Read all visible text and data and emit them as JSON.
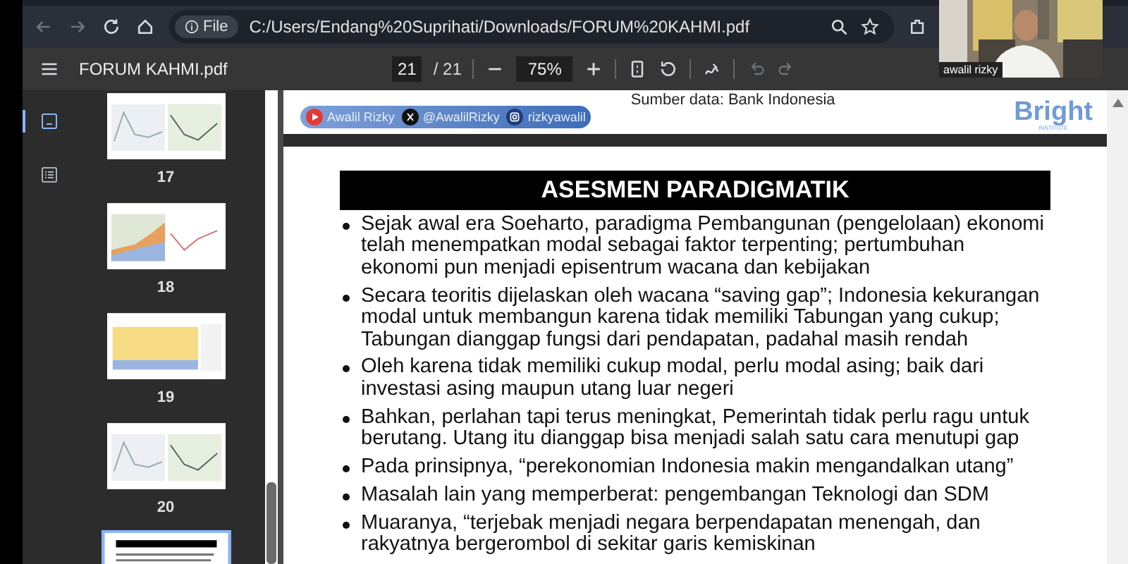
{
  "browser": {
    "scheme": "File",
    "url": "C:/Users/Endang%20Suprihati/Downloads/FORUM%20KAHMI.pdf"
  },
  "pdf_toolbar": {
    "title": "FORUM KAHMI.pdf",
    "page": "21",
    "page_total": "/ 21",
    "zoom": "75%"
  },
  "sidebar": {
    "tabs": [
      {
        "kind": "thumbnails",
        "selected": true
      },
      {
        "kind": "outline",
        "selected": false
      }
    ],
    "thumbnails": [
      {
        "label": "17",
        "selected": false,
        "kind": "lines"
      },
      {
        "label": "18",
        "selected": false,
        "kind": "area"
      },
      {
        "label": "19",
        "selected": false,
        "kind": "bars"
      },
      {
        "label": "20",
        "selected": false,
        "kind": "lines"
      },
      {
        "selected": true,
        "kind": "text"
      }
    ]
  },
  "page_header": {
    "source": "Sumber data: Bank Indonesia",
    "socials": [
      {
        "kind": "youtube",
        "handle": "Awalil Rizky"
      },
      {
        "kind": "x",
        "handle": "@AwalilRizky"
      },
      {
        "kind": "instagram",
        "handle": "rizkyawalil"
      }
    ],
    "logo": {
      "name": "Bright",
      "sub": "INSTITUTE"
    }
  },
  "slide": {
    "title": "ASESMEN PARADIGMATIK",
    "bullets": [
      "Sejak awal era Soeharto, paradigma Pembangunan (pengelolaan) ekonomi telah menempatkan modal sebagai faktor terpenting; pertumbuhan ekonomi pun menjadi episentrum wacana dan kebijakan",
      "Secara teoritis dijelaskan oleh wacana “saving gap”; Indonesia kekurangan modal untuk membangun karena tidak memiliki Tabungan yang cukup; Tabungan dianggap fungsi dari pendapatan, padahal masih rendah",
      "Oleh karena tidak memiliki cukup modal, perlu modal asing; baik dari investasi asing maupun utang luar negeri",
      "Bahkan, perlahan tapi terus meningkat, Pemerintah tidak perlu ragu untuk berutang. Utang itu dianggap bisa menjadi salah satu cara menutupi gap",
      "Pada prinsipnya, “perekonomian Indonesia makin mengandalkan utang”",
      "Masalah lain yang memperberat: pengembangan Teknologi dan SDM",
      "Muaranya, “terjebak menjadi negara berpendapatan menengah, dan rakyatnya bergerombol di sekitar garis kemiskinan"
    ]
  },
  "webcam": {
    "name": "awalil rizky"
  }
}
